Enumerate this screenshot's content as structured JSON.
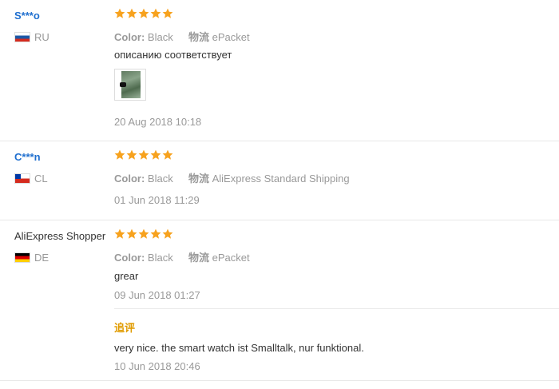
{
  "colors": {
    "star": "#f7a21e",
    "username_link": "#1f6fcf",
    "muted": "#999999",
    "additional_label": "#e09b00"
  },
  "icons": {
    "star": "star-icon",
    "photo": "review-photo"
  },
  "labels": {
    "color": "Color:",
    "shipping": "物流"
  },
  "reviews": [
    {
      "user": "S***o",
      "country": "RU",
      "rating": 5,
      "color": "Black",
      "shipping": "ePacket",
      "text": "описанию соответствует",
      "date": "20 Aug 2018 10:18"
    },
    {
      "user": "C***n",
      "country": "CL",
      "rating": 5,
      "color": "Black",
      "shipping": "AliExpress Standard Shipping",
      "date": "01 Jun 2018 11:29"
    },
    {
      "user": "AliExpress Shopper",
      "country": "DE",
      "rating": 5,
      "color": "Black",
      "shipping": "ePacket",
      "text": "grear",
      "date": "09 Jun 2018 01:27",
      "additional": {
        "label": "追评",
        "text": "very nice. the smart watch ist Smalltalk, nur funktional.",
        "date": "10 Jun 2018 20:46"
      }
    }
  ]
}
